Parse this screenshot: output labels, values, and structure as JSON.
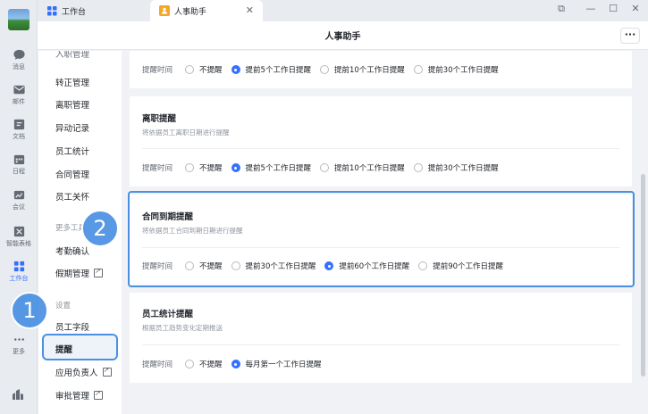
{
  "rail": {
    "items": [
      {
        "label": "消息",
        "icon": "chat-icon"
      },
      {
        "label": "邮件",
        "icon": "mail-icon"
      },
      {
        "label": "文档",
        "icon": "docs-icon"
      },
      {
        "label": "日程",
        "icon": "calendar-icon"
      },
      {
        "label": "会议",
        "icon": "meeting-icon"
      },
      {
        "label": "智能表格",
        "icon": "sheet-icon"
      },
      {
        "label": "工作台",
        "icon": "workbench-icon"
      },
      {
        "label": "更多",
        "icon": "more-icon"
      }
    ],
    "active": "工作台"
  },
  "tabs": [
    {
      "label": "工作台",
      "icon": "grid-icon"
    },
    {
      "label": "人事助手",
      "icon": "hr-assistant-icon"
    }
  ],
  "header": {
    "title": "人事助手",
    "more": "···"
  },
  "sidebar": {
    "partial_top": "入职管理",
    "items_a": [
      "转正管理",
      "离职管理",
      "异动记录",
      "员工统计",
      "合同管理",
      "员工关怀"
    ],
    "group_more": "更多工具",
    "items_b": [
      "考勤确认",
      "假期管理"
    ],
    "group_settings": "设置",
    "items_c": [
      "员工字段",
      "提醒",
      "应用负责人",
      "审批管理"
    ]
  },
  "cards": {
    "top": {
      "row_label": "提醒时间",
      "options": [
        "不提醒",
        "提前5个工作日提醒",
        "提前10个工作日提醒",
        "提前30个工作日提醒"
      ],
      "selected": 1
    },
    "resign": {
      "title": "离职提醒",
      "desc": "将依据员工离职日期进行提醒",
      "row_label": "提醒时间",
      "options": [
        "不提醒",
        "提前5个工作日提醒",
        "提前10个工作日提醒",
        "提前30个工作日提醒"
      ],
      "selected": 1
    },
    "contract": {
      "title": "合同到期提醒",
      "desc": "将依据员工合同到期日期进行提醒",
      "row_label": "提醒时间",
      "options": [
        "不提醒",
        "提前30个工作日提醒",
        "提前60个工作日提醒",
        "提前90个工作日提醒"
      ],
      "selected": 2
    },
    "stats": {
      "title": "员工统计提醒",
      "desc": "根据员工趋势变化定期推送",
      "row_label": "提醒时间",
      "options": [
        "不提醒",
        "每月第一个工作日提醒"
      ],
      "selected": 1
    }
  },
  "callouts": {
    "one": "1",
    "two": "2"
  },
  "colors": {
    "accent": "#3370ff",
    "callout": "#4a90e2"
  }
}
